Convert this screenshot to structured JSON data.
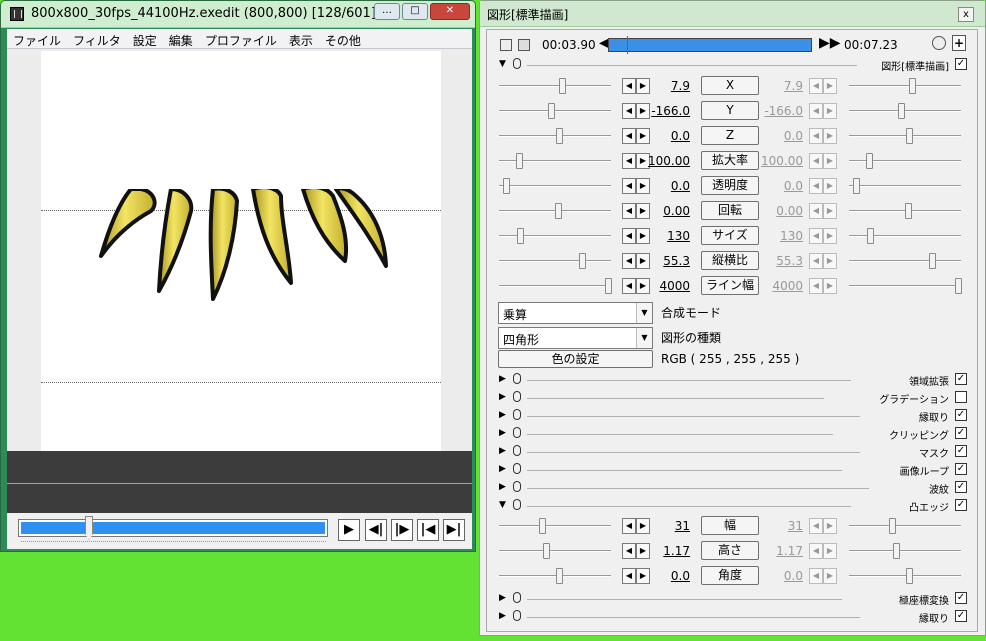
{
  "preview_window": {
    "title": "800x800_30fps_44100Hz.exedit (800,800)  [128/601]  ...",
    "title_buttons": [
      "…",
      "□",
      "✕"
    ],
    "menu": [
      "ファイル",
      "フィルタ",
      "設定",
      "編集",
      "プロファイル",
      "表示",
      "その他"
    ],
    "play_buttons": [
      "▶",
      "◀|",
      "|▶",
      "|◀",
      "▶|"
    ]
  },
  "settings_window": {
    "title": "図形[標準描画]",
    "close": "x",
    "time_current": "00:03.90",
    "time_end": "00:07.23",
    "timeline_progress": 0.09,
    "header_plus": "+",
    "header_label": "図形[標準描画]",
    "params": [
      {
        "name": "X",
        "value": "7.9",
        "end": "7.9"
      },
      {
        "name": "Y",
        "value": "-166.0",
        "end": "-166.0"
      },
      {
        "name": "Z",
        "value": "0.0",
        "end": "0.0"
      },
      {
        "name": "拡大率",
        "value": "100.00",
        "end": "100.00"
      },
      {
        "name": "透明度",
        "value": "0.0",
        "end": "0.0"
      },
      {
        "name": "回転",
        "value": "0.00",
        "end": "0.00"
      },
      {
        "name": "サイズ",
        "value": "130",
        "end": "130"
      },
      {
        "name": "縦横比",
        "value": "55.3",
        "end": "55.3"
      },
      {
        "name": "ライン幅",
        "value": "4000",
        "end": "4000"
      }
    ],
    "blend_mode_value": "乗算",
    "blend_mode_label": "合成モード",
    "shape_value": "四角形",
    "shape_label": "図形の種類",
    "color_button": "色の設定",
    "color_value": "RGB ( 255 , 255 , 255 )",
    "filters": [
      {
        "name": "領域拡張",
        "checked": true
      },
      {
        "name": "グラデーション",
        "checked": false
      },
      {
        "name": "縁取り",
        "checked": true
      },
      {
        "name": "クリッピング",
        "checked": true
      },
      {
        "name": "マスク",
        "checked": true
      },
      {
        "name": "画像ループ",
        "checked": true
      },
      {
        "name": "波紋",
        "checked": true
      },
      {
        "name": "凸エッジ",
        "checked": true
      }
    ],
    "edge_params": [
      {
        "name": "幅",
        "value": "31",
        "end": "31"
      },
      {
        "name": "高さ",
        "value": "1.17",
        "end": "1.17"
      },
      {
        "name": "角度",
        "value": "0.0",
        "end": "0.0"
      }
    ],
    "tail_filters": [
      {
        "name": "極座標変換",
        "checked": true
      },
      {
        "name": "縁取り",
        "checked": true
      }
    ]
  },
  "colors": {
    "desktop": "#62e233",
    "timeline_fill": "#3c8fe6",
    "petal": "#e8d84a"
  }
}
